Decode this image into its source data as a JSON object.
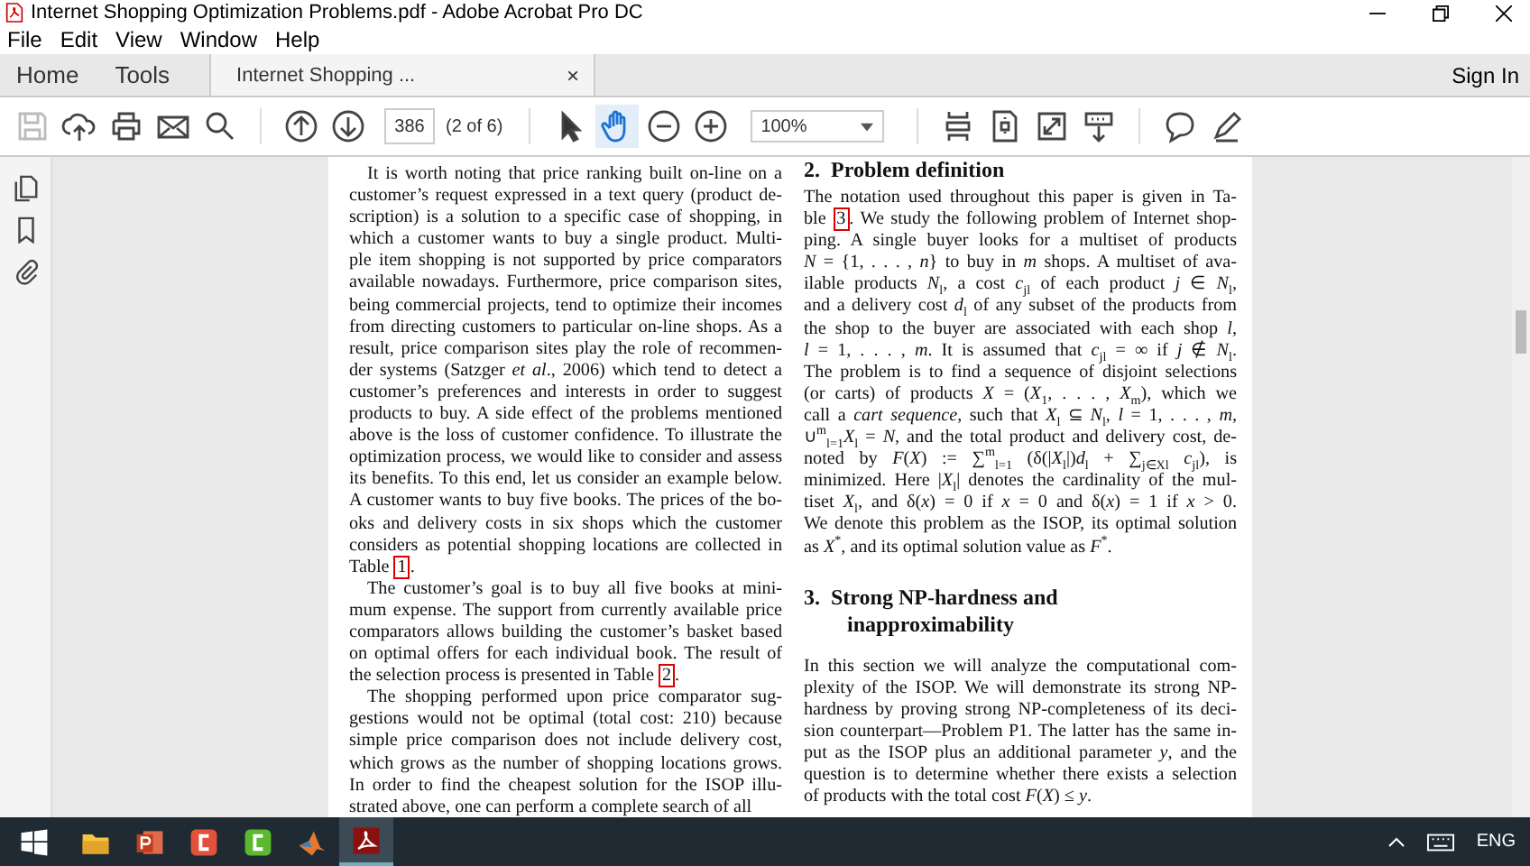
{
  "window": {
    "title": "Internet Shopping Optimization Problems.pdf - Adobe Acrobat Pro DC"
  },
  "menu": [
    "File",
    "Edit",
    "View",
    "Window",
    "Help"
  ],
  "tabs": [
    {
      "label": "Home",
      "kind": "nav",
      "selected": false
    },
    {
      "label": "Tools",
      "kind": "nav",
      "selected": false
    },
    {
      "label": "Internet Shopping ...",
      "kind": "document",
      "selected": true,
      "close": "×"
    }
  ],
  "sign_in": "Sign In",
  "toolbar": [
    {
      "kind": "save",
      "disabled": true,
      "selected": false
    },
    {
      "kind": "upload",
      "disabled": false,
      "selected": false
    },
    {
      "kind": "print",
      "disabled": false,
      "selected": false
    },
    {
      "kind": "mail",
      "disabled": false,
      "selected": false
    },
    {
      "kind": "search",
      "disabled": false,
      "selected": false
    },
    {
      "kind": "separator"
    },
    {
      "kind": "prev-page",
      "disabled": false,
      "selected": false
    },
    {
      "kind": "next-page",
      "disabled": false,
      "selected": false
    },
    {
      "kind": "page-field",
      "value": "386"
    },
    {
      "kind": "page-count",
      "text": "(2 of 6)"
    },
    {
      "kind": "separator"
    },
    {
      "kind": "select",
      "disabled": false,
      "selected": false
    },
    {
      "kind": "hand",
      "disabled": false,
      "selected": true
    },
    {
      "kind": "zoom-out",
      "disabled": false,
      "selected": false
    },
    {
      "kind": "zoom-in",
      "disabled": false,
      "selected": false
    },
    {
      "kind": "zoom-field",
      "value": "100%"
    },
    {
      "kind": "separator"
    },
    {
      "kind": "fit-page",
      "disabled": false,
      "selected": false
    },
    {
      "kind": "rotate",
      "disabled": false,
      "selected": false
    },
    {
      "kind": "fullscreen",
      "disabled": false,
      "selected": false
    },
    {
      "kind": "scroll",
      "disabled": false,
      "selected": false
    },
    {
      "kind": "separator"
    },
    {
      "kind": "comment",
      "disabled": false,
      "selected": false
    },
    {
      "kind": "pen",
      "disabled": false,
      "selected": false
    }
  ],
  "nav_pane": [
    {
      "kind": "pages"
    },
    {
      "kind": "bookmark"
    },
    {
      "kind": "attachment"
    }
  ],
  "page": {
    "left_column": [
      {
        "lines": [
          "It is worth noting that price ranking built on-line on a",
          "customer’s request expressed in a text query (product de-",
          "scription) is a solution to a specific case of shopping, in",
          "which a customer wants to buy a single product. Multi-",
          "ple item shopping is not supported by price comparators",
          "available nowadays. Furthermore, price comparison sites,",
          "being commercial projects, tend to optimize their incomes",
          "from directing customers to particular on-line shops. As a",
          "result, price comparison sites play the role of recommen-",
          "der systems (Satzger *et al*., 2006) which tend to detect a",
          "customer’s preferences and interests in order to suggest",
          "products to buy. A side effect of the problems mentioned",
          "above is the loss of customer confidence. To illustrate the",
          "optimization process, we would like to consider and assess",
          "its benefits. To this end, let us consider an example below.",
          "A customer wants to buy five books. The prices of the bo-",
          "oks and delivery costs in six shops which the customer",
          "considers as potential shopping locations are collected in",
          {
            "text": "Table ",
            "link": "1",
            "after": "."
          }
        ]
      },
      {
        "lines": [
          "The customer’s goal is to buy all five books at mini-",
          "mum expense. The support from currently available price",
          "comparators allows building the customer’s basket based",
          "on optimal offers for each individual book. The result of",
          {
            "text": "the selection process is presented in Table ",
            "link": "2",
            "after": "."
          }
        ]
      },
      {
        "lines": [
          "The shopping performed upon price comparator sug-",
          "gestions would not be optimal (total cost: 210) because",
          "simple price comparison does not include delivery cost,",
          "which grows as the number of shopping locations grows.",
          "In order to find the cheapest solution for the ISOP illu-",
          "strated above, one can perform a complete search of all"
        ]
      }
    ],
    "right_column": [
      {
        "kind": "heading",
        "lines": [
          "2.  Problem definition"
        ]
      },
      {
        "kind": "paragraph",
        "lines": [
          "The notation used throughout this paper is given in Ta-",
          {
            "text": "ble ",
            "link": "3",
            "after": ". We study the following problem of Internet shop-"
          },
          "ping. A single buyer looks for a multiset of products",
          "*N* = {1, . . . , *n*} to buy in *m* shops. A multiset of ava-",
          "ilable products *N*$_{l}$, a cost *c*$_{jl}$ of each product *j* ∈ *N*$_{l}$,",
          "and a delivery cost *d*$_{l}$ of any subset of the products from",
          "the shop to the buyer are associated with each shop *l*,",
          "*l* = 1, . . . , *m*. It is assumed that *c*$_{jl}$ = ∞ if *j* ∉ *N*$_{l}$.",
          "The problem is to find a sequence of disjoint selections",
          "(or carts) of products *X* = (*X*$_{1}$, . . . , *X*$_{m}$), which we",
          "call a *cart sequence*, such that *X*$_{l}$ ⊆ *N*$_{l}$, *l* = 1, . . . , *m*,",
          "∪$^{m}$$_{l=1}$*X*$_{l}$ = *N*, and the total product and delivery cost, de-",
          "noted by *F*(*X*) := ∑$^{m}$$_{l=1}$ (δ(|*X*$_{l}$|)*d*$_{l}$ + ∑$_{j∈Xl}$ *c*$_{jl}$), is",
          "minimized. Here |*X*$_{l}$| denotes the cardinality of the mul-",
          "tiset *X*$_{l}$, and δ(*x*) = 0 if *x* = 0 and δ(*x*) = 1 if *x* > 0.",
          "We denote this problem as the ISOP, its optimal solution",
          "as *X*$^{*}$, and its optimal solution value as *F*$^{*}$."
        ]
      },
      {
        "kind": "heading",
        "lines": [
          "3.  Strong NP-hardness and",
          "inapproximability"
        ]
      },
      {
        "kind": "paragraph",
        "lines": [
          "In this section we will analyze the computational com-",
          "plexity of the ISOP. We will demonstrate its strong NP-",
          "hardness by proving strong NP-completeness of its deci-",
          "sion counterpart—Problem P1. The latter has the same in-",
          "put as the ISOP plus an additional parameter *y*, and the",
          "question is to determine whether there exists a selection",
          "of products with the total cost *F*(*X*) ≤ *y*."
        ]
      }
    ]
  },
  "taskbar": {
    "apps": [
      {
        "kind": "start",
        "selected": false
      },
      {
        "kind": "explorer",
        "selected": false
      },
      {
        "kind": "powerpoint",
        "selected": false
      },
      {
        "kind": "recorder-red",
        "selected": false
      },
      {
        "kind": "recorder-green",
        "selected": false
      },
      {
        "kind": "matlab",
        "selected": false
      },
      {
        "kind": "acrobat",
        "selected": true
      }
    ],
    "language": "ENG"
  }
}
